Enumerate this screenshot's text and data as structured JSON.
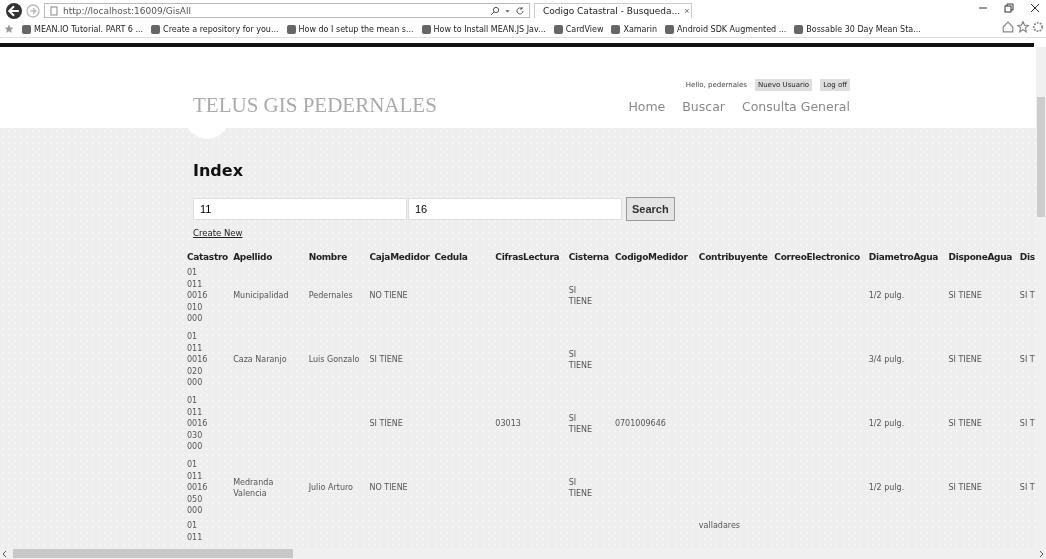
{
  "browser": {
    "address": "http://localhost:16009/GisAll",
    "tab": {
      "title": "Codigo Catastral - Busqueda...",
      "close": "×"
    },
    "favorites": [
      {
        "label": "MEAN.IO Tutorial. PART 6 ..."
      },
      {
        "label": "Create a repository for you..."
      },
      {
        "label": "How do I setup the mean s..."
      },
      {
        "label": "How to Install MEAN.JS Jav..."
      },
      {
        "label": "CardView"
      },
      {
        "label": "Xamarin"
      },
      {
        "label": "Android SDK Augmented ..."
      },
      {
        "label": "Bossable 30 Day Mean Sta..."
      }
    ]
  },
  "header": {
    "brand": "TELUS GIS PEDERNALES",
    "greeting": "Hello, pedernales",
    "user_buttons": [
      "Nuevo Usuario",
      "Log off"
    ],
    "nav": [
      "Home",
      "Buscar",
      "Consulta General"
    ]
  },
  "main": {
    "heading": "Index",
    "search_fields": [
      {
        "value": "11"
      },
      {
        "value": "16"
      }
    ],
    "search_button": "Search",
    "create_link": "Create New"
  },
  "table": {
    "columns": [
      "Catastro",
      "Apellido",
      "Nombre",
      "CajaMedidor",
      "Cedula",
      "CifrasLectura",
      "Cisterna",
      "CodigoMedidor",
      "Contribuyente",
      "CorreoElectronico",
      "DiametroAgua",
      "DisponeAgua",
      "Dis"
    ],
    "rows": [
      {
        "catastro": "01 011 0016 010 000",
        "apellido": "Municipalidad",
        "nombre": "Pedernales",
        "caja_medidor": "NO TIENE",
        "cisterna": "SI TIENE",
        "diametro_agua": "1/2 pulg.",
        "dispone_agua": "SI TIENE",
        "column_13": "SI T"
      },
      {
        "catastro": "01 011 0016 020 000",
        "apellido": "Caza Naranjo",
        "nombre": "Luis Gonzalo",
        "caja_medidor": "SI TIENE",
        "cisterna": "SI TIENE",
        "diametro_agua": "3/4 pulg.",
        "dispone_agua": "SI TIENE",
        "column_13": "SI T"
      },
      {
        "catastro": "01 011 0016 030 000",
        "caja_medidor": "SI TIENE",
        "cifras_lectura": "03013",
        "cisterna": "SI TIENE",
        "codigo_medidor": "0701009646",
        "diametro_agua": "1/2 pulg.",
        "dispone_agua": "SI TIENE",
        "column_13": "SI T"
      },
      {
        "catastro": "01 011 0016 050 000",
        "apellido": "Medranda Valencia",
        "nombre": "Julio Arturo",
        "caja_medidor": "NO TIENE",
        "cisterna": "SI TIENE",
        "diametro_agua": "1/2 pulg.",
        "dispone_agua": "SI TIENE",
        "column_13": "SI T"
      },
      {
        "catastro": "01 011",
        "contribuyente": "valladares"
      }
    ]
  }
}
